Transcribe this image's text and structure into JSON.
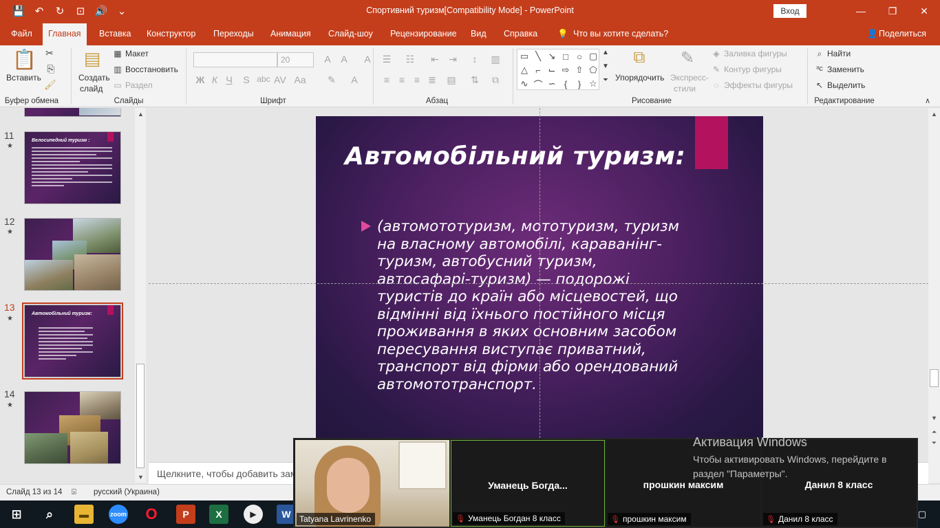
{
  "window": {
    "title": "Спортивний туризм[Compatibility Mode]  -  PowerPoint",
    "signin_label": "Вход",
    "minimize": "—",
    "restore": "❐",
    "close": "✕"
  },
  "qat": {
    "save": "💾",
    "undo": "↶",
    "redo": "↻",
    "present": "⊡",
    "audio": "🔊",
    "customize": "⌄"
  },
  "tabs": [
    "Файл",
    "Главная",
    "Вставка",
    "Конструктор",
    "Переходы",
    "Анимация",
    "Слайд-шоу",
    "Рецензирование",
    "Вид",
    "Справка"
  ],
  "active_tab": "Главная",
  "tell_me": "Что вы хотите сделать?",
  "share": "Поделиться",
  "ribbon": {
    "clipboard": {
      "label": "Буфер обмена",
      "paste": "Вставить"
    },
    "slides": {
      "label": "Слайды",
      "new_slide_1": "Создать",
      "new_slide_2": "слайд",
      "layout": "Макет",
      "reset": "Восстановить",
      "section": "Раздел"
    },
    "font": {
      "label": "Шрифт",
      "size": "20",
      "bold": "Ж",
      "italic": "К",
      "underline": "Ч",
      "strike": "S",
      "case": "Aa"
    },
    "paragraph": {
      "label": "Абзац"
    },
    "drawing": {
      "label": "Рисование",
      "arrange": "Упорядочить",
      "quick_styles_1": "Экспресс-",
      "quick_styles_2": "стили",
      "fill": "Заливка фигуры",
      "outline": "Контур фигуры",
      "effects": "Эффекты фигуры"
    },
    "editing": {
      "label": "Редактирование",
      "find": "Найти",
      "replace": "Заменить",
      "select": "Выделить"
    }
  },
  "thumbnails": [
    {
      "num": "11",
      "title": "Велосипедний туризм :"
    },
    {
      "num": "12"
    },
    {
      "num": "13",
      "title": "Автомобільний туризм:"
    },
    {
      "num": "14"
    }
  ],
  "slide": {
    "title": "Автомобільний туризм:",
    "body": "(автомототуризм, мототуризм, туризм на власному автомобілі, караванінг-туризм, автобусний туризм, автосафарі-туризм) — подорожі туристів до країн або місцевостей, що відмінні від їхнього постійного місця проживання в яких основним засобом пересування виступає приватний, транспорт від фірми або орендований автомототранспорт.",
    "colors": {
      "accent_bar": "#b3125f",
      "bullet": "#e24a9b"
    }
  },
  "notes_placeholder": "Щелкните, чтобы добавить заметки",
  "status": {
    "slide_counter": "Слайд 13 из 14",
    "language": "русский (Украина)"
  },
  "zoom": {
    "self_name": "Tatyana Lavrinenko",
    "participants": [
      {
        "name": "Уманець  Богда...",
        "label": "Уманець Богдан 8 класс"
      },
      {
        "name": "прошкин максим",
        "label": "прошкин максим"
      },
      {
        "name": "Данил 8 класс",
        "label": "Данил 8 класс"
      }
    ]
  },
  "activation": {
    "heading": "Активация Windows",
    "text": "Чтобы активировать Windows, перейдите в раздел \"Параметры\"."
  },
  "taskbar": {
    "apps": [
      "start-icon",
      "search-icon",
      "file-explorer-icon",
      "zoom-icon",
      "opera-icon",
      "powerpoint-icon",
      "excel-icon",
      "media-player-icon",
      "word-icon"
    ]
  },
  "brand_color": "#c43e1c"
}
